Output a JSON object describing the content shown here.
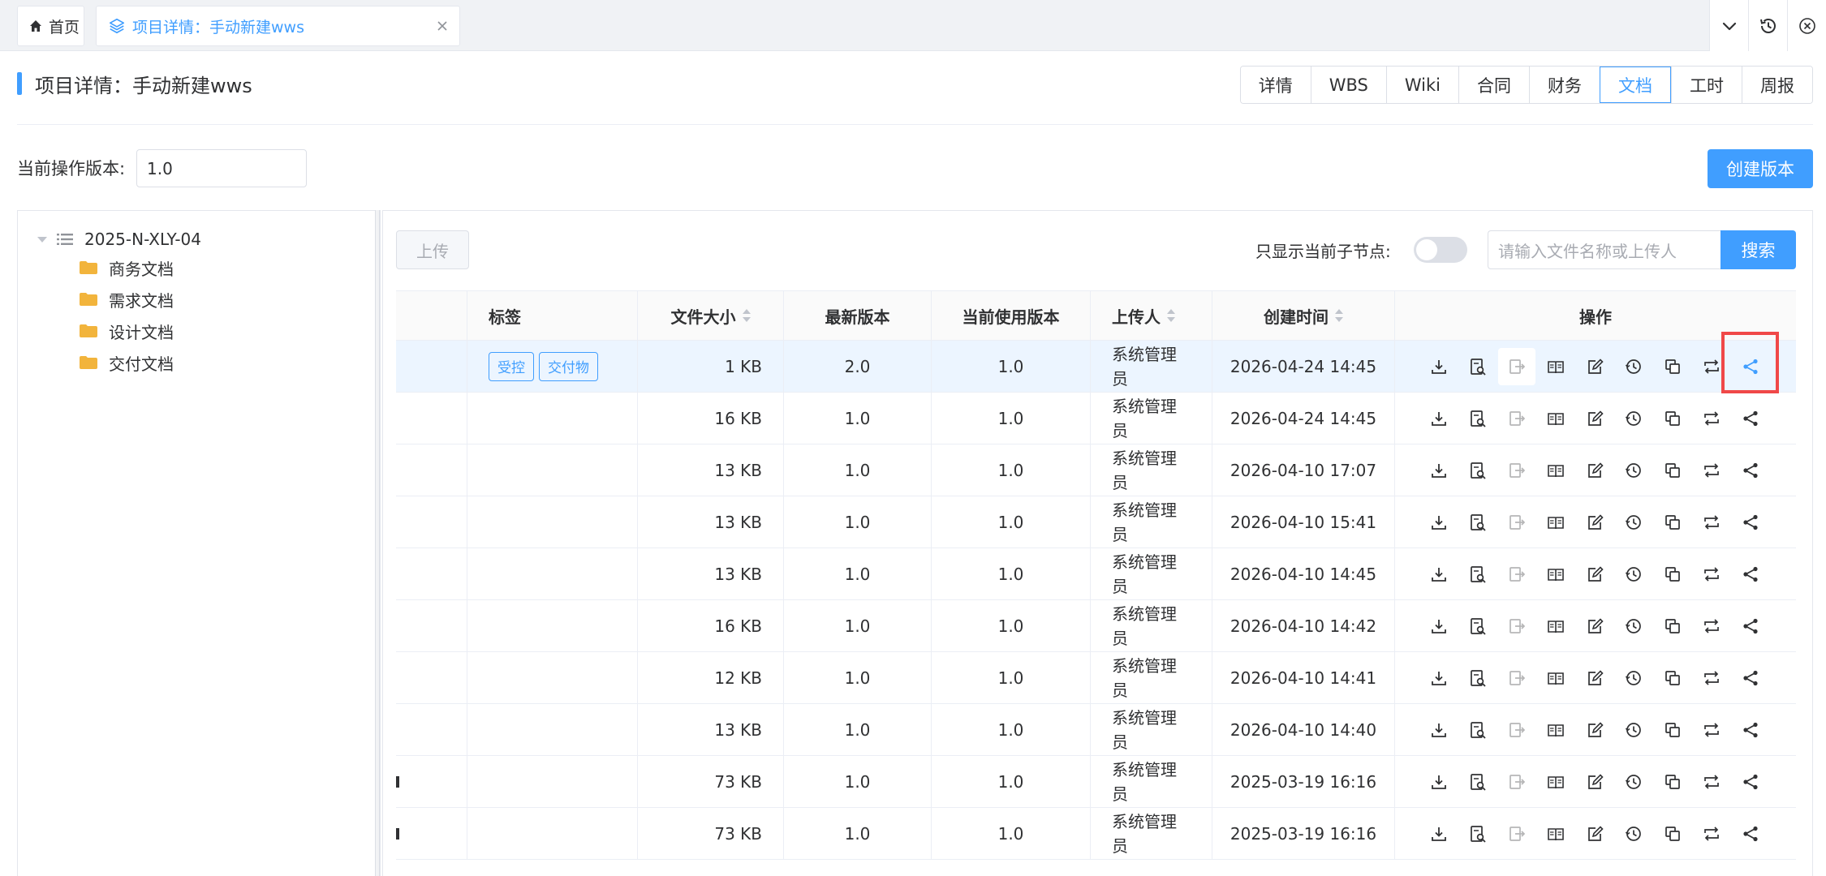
{
  "tabs": {
    "home_label": "首页",
    "active_label": "项目详情：手动新建wws"
  },
  "page": {
    "title": "项目详情：手动新建wws"
  },
  "subnav": [
    {
      "label": "详情",
      "active": false
    },
    {
      "label": "WBS",
      "active": false
    },
    {
      "label": "Wiki",
      "active": false
    },
    {
      "label": "合同",
      "active": false
    },
    {
      "label": "财务",
      "active": false
    },
    {
      "label": "文档",
      "active": true
    },
    {
      "label": "工时",
      "active": false
    },
    {
      "label": "周报",
      "active": false
    }
  ],
  "version": {
    "label": "当前操作版本:",
    "value": "1.0",
    "create_button": "创建版本"
  },
  "tree": {
    "root": "2025-N-XLY-04",
    "children": [
      "商务文档",
      "需求文档",
      "设计文档",
      "交付文档"
    ]
  },
  "toolbar": {
    "upload_label": "上传",
    "only_current_label": "只显示当前子节点:",
    "search_placeholder": "请输入文件名称或上传人",
    "search_button": "搜索"
  },
  "table": {
    "headers": {
      "tags": "标签",
      "size": "文件大小",
      "latest": "最新版本",
      "current": "当前使用版本",
      "uploader": "上传人",
      "created": "创建时间",
      "ops": "操作"
    },
    "rows": [
      {
        "tags": [
          "受控",
          "交付物"
        ],
        "size": "1 KB",
        "latest": "2.0",
        "current": "1.0",
        "uploader": "系统管理员",
        "created": "2026-04-24 14:45"
      },
      {
        "tags": [],
        "size": "16 KB",
        "latest": "1.0",
        "current": "1.0",
        "uploader": "系统管理员",
        "created": "2026-04-24 14:45"
      },
      {
        "tags": [],
        "size": "13 KB",
        "latest": "1.0",
        "current": "1.0",
        "uploader": "系统管理员",
        "created": "2026-04-10 17:07"
      },
      {
        "tags": [],
        "size": "13 KB",
        "latest": "1.0",
        "current": "1.0",
        "uploader": "系统管理员",
        "created": "2026-04-10 15:41"
      },
      {
        "tags": [],
        "size": "13 KB",
        "latest": "1.0",
        "current": "1.0",
        "uploader": "系统管理员",
        "created": "2026-04-10 14:45"
      },
      {
        "tags": [],
        "size": "16 KB",
        "latest": "1.0",
        "current": "1.0",
        "uploader": "系统管理员",
        "created": "2026-04-10 14:42"
      },
      {
        "tags": [],
        "size": "12 KB",
        "latest": "1.0",
        "current": "1.0",
        "uploader": "系统管理员",
        "created": "2026-04-10 14:41"
      },
      {
        "tags": [],
        "size": "13 KB",
        "latest": "1.0",
        "current": "1.0",
        "uploader": "系统管理员",
        "created": "2026-04-10 14:40"
      },
      {
        "tags": [],
        "size": "73 KB",
        "latest": "1.0",
        "current": "1.0",
        "uploader": "系统管理员",
        "created": "2025-03-19 16:16"
      },
      {
        "tags": [],
        "size": "73 KB",
        "latest": "1.0",
        "current": "1.0",
        "uploader": "系统管理员",
        "created": "2025-03-19 16:16"
      }
    ],
    "op_icons": [
      "download-icon",
      "preview-icon",
      "checkout-icon",
      "read-icon",
      "edit-icon",
      "history-icon",
      "copy-icon",
      "replace-icon",
      "share-icon"
    ]
  },
  "colors": {
    "primary": "#409eff",
    "highlight_border": "#f04848",
    "selected_row": "#ecf5ff"
  }
}
